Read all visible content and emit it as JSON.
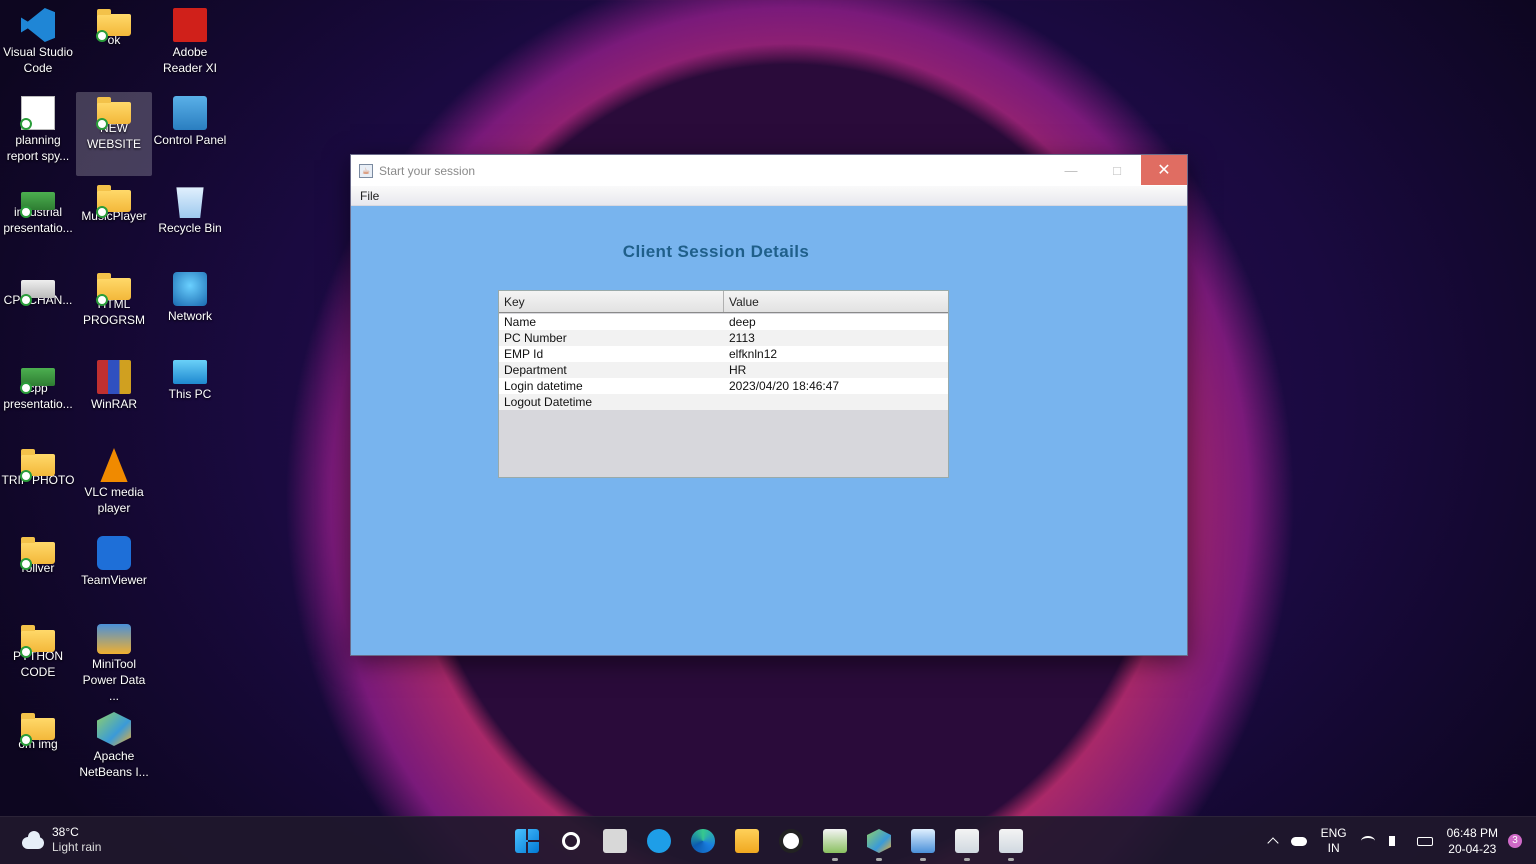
{
  "desktop": {
    "icons": [
      {
        "label": "Visual Studio Code",
        "icon": "vscode-icon"
      },
      {
        "label": "ok",
        "icon": "folder-icon"
      },
      {
        "label": "Adobe Reader XI",
        "icon": "pdf-icon"
      },
      {
        "label": "planning report spy...",
        "icon": "document-icon"
      },
      {
        "label": "NEW WEBSITE",
        "icon": "folder-icon"
      },
      {
        "label": "Control Panel",
        "icon": "control-panel-icon"
      },
      {
        "label": "industrial presentatio...",
        "icon": "presentation-icon"
      },
      {
        "label": "MusicPlayer",
        "icon": "folder-icon"
      },
      {
        "label": "Recycle Bin",
        "icon": "recycle-bin-icon"
      },
      {
        "label": "CPPCHAN...",
        "icon": "presentation-icon"
      },
      {
        "label": "HTML PROGRSM",
        "icon": "folder-icon"
      },
      {
        "label": "Network",
        "icon": "network-icon"
      },
      {
        "label": "cpp presentatio...",
        "icon": "presentation-icon"
      },
      {
        "label": "WinRAR",
        "icon": "winrar-icon"
      },
      {
        "label": "This PC",
        "icon": "monitor-icon"
      },
      {
        "label": "TRIP PHOTO",
        "icon": "folder-icon"
      },
      {
        "label": "VLC media player",
        "icon": "vlc-icon"
      },
      {
        "label": "rollver",
        "icon": "folder-icon"
      },
      {
        "label": "TeamViewer",
        "icon": "teamviewer-icon"
      },
      {
        "label": "PYTHON CODE",
        "icon": "folder-icon"
      },
      {
        "label": "MiniTool Power Data ...",
        "icon": "minitool-icon"
      },
      {
        "label": "om img",
        "icon": "folder-icon"
      },
      {
        "label": "Apache NetBeans I...",
        "icon": "netbeans-icon"
      }
    ]
  },
  "window": {
    "title": "Start your session",
    "menu_file": "File",
    "heading": "Client Session Details",
    "columns": [
      "Key",
      "Value"
    ],
    "rows": [
      {
        "key": "Name",
        "value": "deep"
      },
      {
        "key": "PC Number",
        "value": "2113"
      },
      {
        "key": "EMP Id",
        "value": "elfknln12"
      },
      {
        "key": "Department",
        "value": "HR"
      },
      {
        "key": "Login datetime",
        "value": "2023/04/20 18:46:47"
      },
      {
        "key": "Logout Datetime",
        "value": ""
      }
    ],
    "colors": {
      "content_bg": "#78b4ee",
      "heading": "#1f5f8a",
      "close_btn": "#e06d62"
    }
  },
  "taskbar": {
    "weather": {
      "temp": "38°C",
      "desc": "Light rain"
    },
    "lang_top": "ENG",
    "lang_bottom": "IN",
    "time": "06:48 PM",
    "date": "20-04-23",
    "notifications": "3"
  }
}
